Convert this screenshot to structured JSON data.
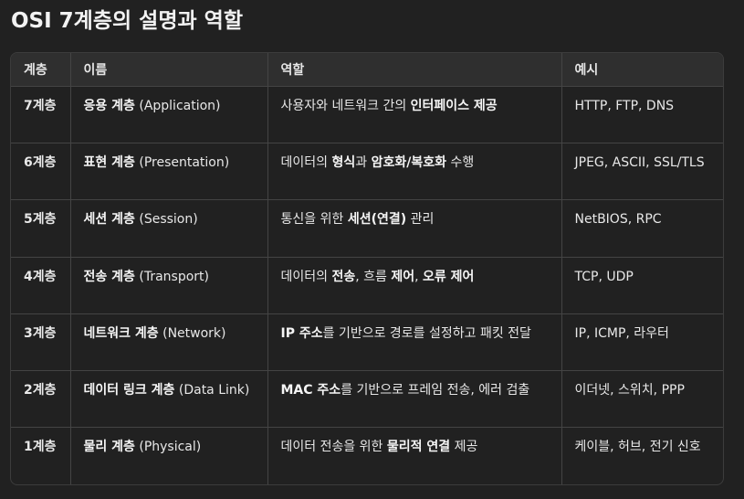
{
  "title": "OSI 7계층의 설명과 역할",
  "headers": [
    "계층",
    "이름",
    "역할",
    "예시"
  ],
  "rows": [
    {
      "layer": "7계층",
      "name_bold": "응용 계층",
      "name_rest": " (Application)",
      "role": [
        {
          "t": "사용자와 네트워크 간의 ",
          "b": false
        },
        {
          "t": "인터페이스 제공",
          "b": true
        }
      ],
      "example": "HTTP, FTP, DNS"
    },
    {
      "layer": "6계층",
      "name_bold": "표현 계층",
      "name_rest": " (Presentation)",
      "role": [
        {
          "t": "데이터의 ",
          "b": false
        },
        {
          "t": "형식",
          "b": true
        },
        {
          "t": "과 ",
          "b": false
        },
        {
          "t": "암호화/복호화",
          "b": true
        },
        {
          "t": " 수행",
          "b": false
        }
      ],
      "example": "JPEG, ASCII, SSL/TLS"
    },
    {
      "layer": "5계층",
      "name_bold": "세션 계층",
      "name_rest": " (Session)",
      "role": [
        {
          "t": "통신을 위한 ",
          "b": false
        },
        {
          "t": "세션(연결)",
          "b": true
        },
        {
          "t": " 관리",
          "b": false
        }
      ],
      "example": "NetBIOS, RPC"
    },
    {
      "layer": "4계층",
      "name_bold": "전송 계층",
      "name_rest": " (Transport)",
      "role": [
        {
          "t": "데이터의 ",
          "b": false
        },
        {
          "t": "전송",
          "b": true
        },
        {
          "t": ", 흐름 ",
          "b": false
        },
        {
          "t": "제어",
          "b": true
        },
        {
          "t": ", ",
          "b": false
        },
        {
          "t": "오류 제어",
          "b": true
        }
      ],
      "example": "TCP, UDP"
    },
    {
      "layer": "3계층",
      "name_bold": "네트워크 계층",
      "name_rest": " (Network)",
      "role": [
        {
          "t": "IP 주소",
          "b": true
        },
        {
          "t": "를 기반으로 경로를 설정하고 패킷 전달",
          "b": false
        }
      ],
      "example": "IP, ICMP, 라우터"
    },
    {
      "layer": "2계층",
      "name_bold": "데이터 링크 계층",
      "name_rest": " (Data Link)",
      "role": [
        {
          "t": "MAC 주소",
          "b": true
        },
        {
          "t": "를 기반으로 프레임 전송, 에러 검출",
          "b": false
        }
      ],
      "example": "이더넷, 스위치, PPP"
    },
    {
      "layer": "1계층",
      "name_bold": "물리 계층",
      "name_rest": " (Physical)",
      "role": [
        {
          "t": "데이터 전송을 위한 ",
          "b": false
        },
        {
          "t": "물리적 연결",
          "b": true
        },
        {
          "t": " 제공",
          "b": false
        }
      ],
      "example": "케이블, 허브, 전기 신호"
    }
  ]
}
